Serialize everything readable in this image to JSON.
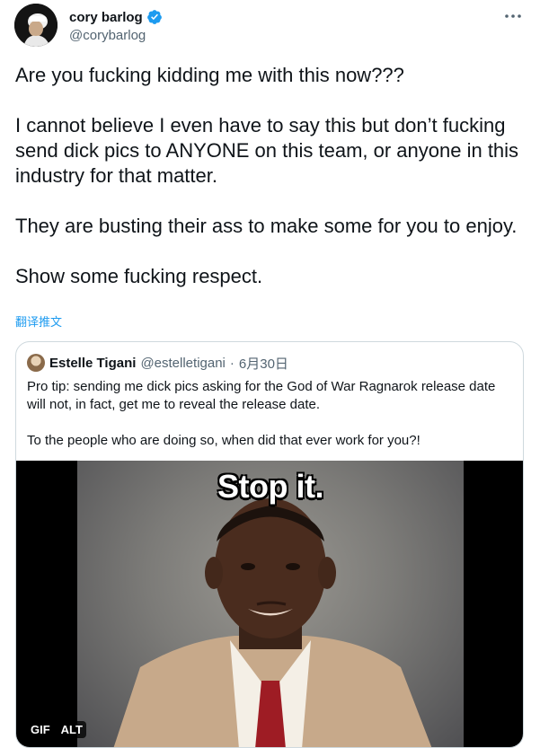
{
  "author": {
    "display_name": "cory barlog",
    "handle": "@corybarlog",
    "verified": true
  },
  "tweet": {
    "text": "Are you fucking kidding me with this now???\n\nI cannot believe I even have to say this but don’t fucking send dick pics to ANYONE on this team, or anyone in this industry for that matter.\n\nThey are busting their ass to make some for you to enjoy.\n\nShow some fucking respect.",
    "translate_label": "翻译推文"
  },
  "quote": {
    "display_name": "Estelle Tigani",
    "handle": "@estelletigani",
    "separator": "·",
    "date": "6月30日",
    "text": "Pro tip: sending me dick pics asking for the God of War Ragnarok release date will not, in fact, get me to reveal the release date.\n\nTo the people who are doing so, when did that ever work for you?!",
    "media": {
      "caption": "Stop it.",
      "badge_gif": "GIF",
      "badge_alt": "ALT"
    }
  },
  "icons": {
    "verified": "verified-badge-icon",
    "more": "more-options-icon"
  },
  "colors": {
    "accent": "#1d9bf0",
    "secondary_text": "#536471",
    "border": "#cfd9de"
  }
}
